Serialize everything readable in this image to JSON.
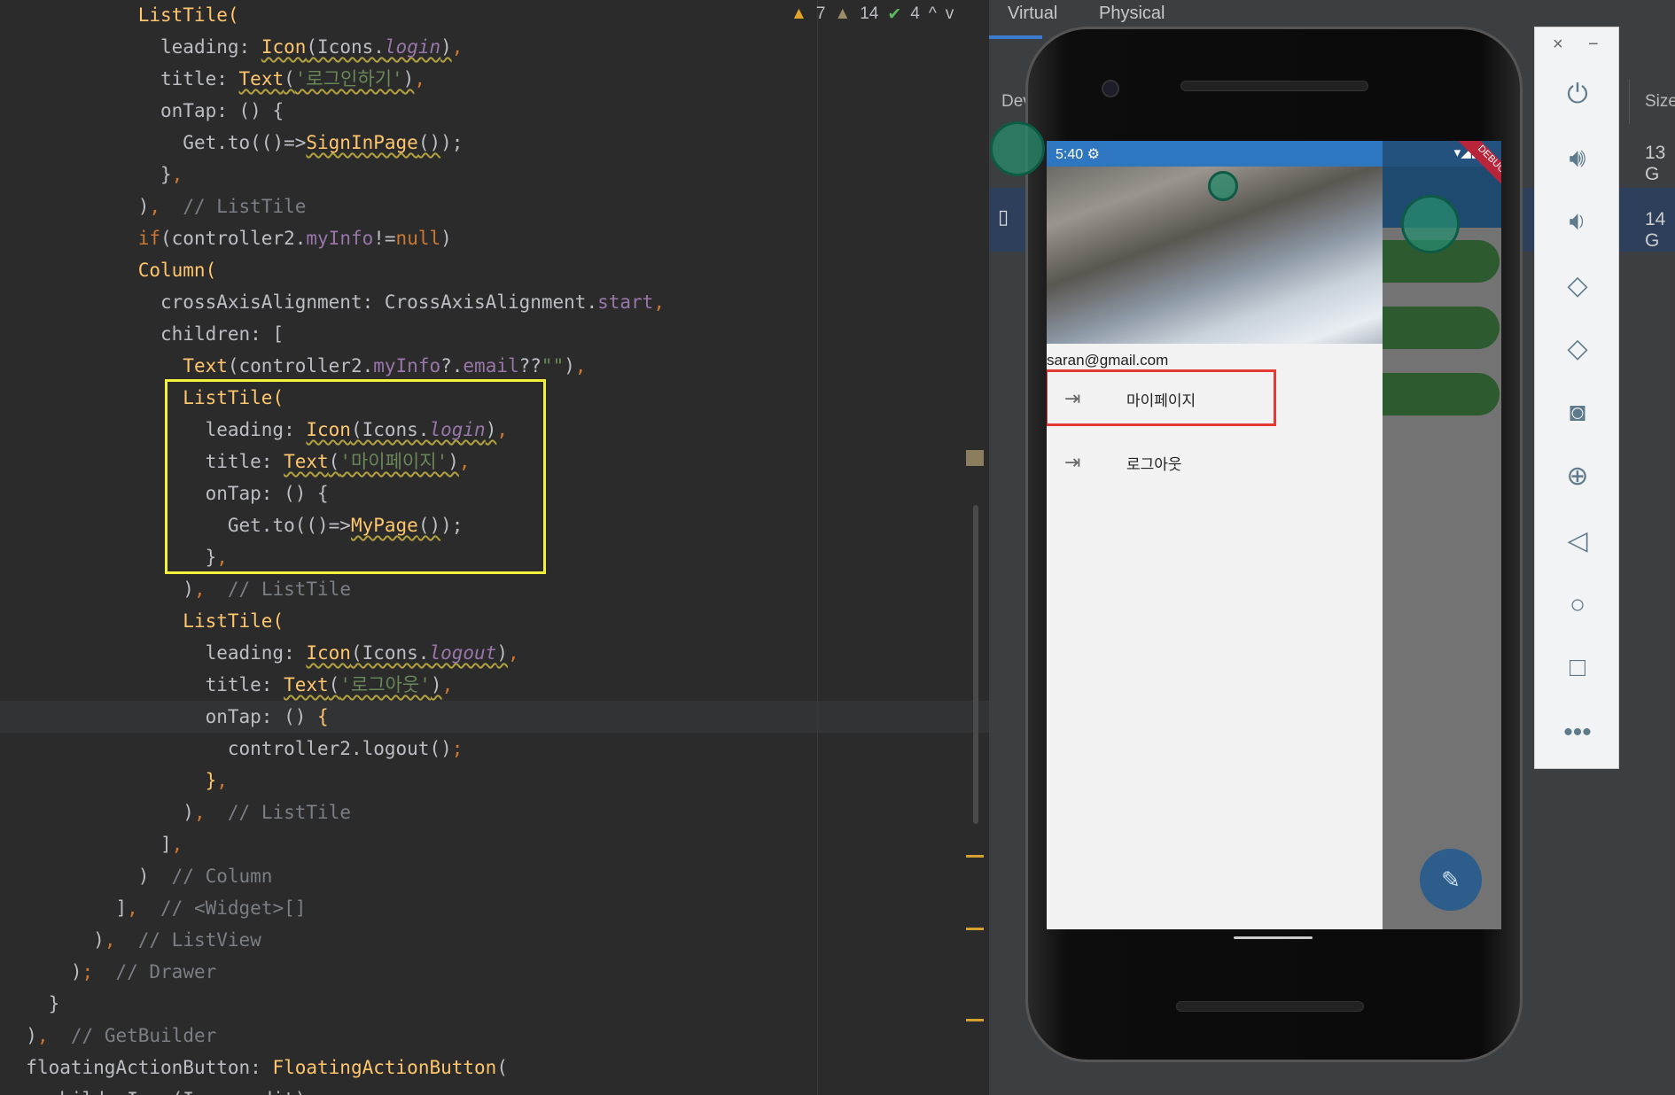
{
  "editor": {
    "inspections": {
      "warnings": "7",
      "weak_warnings": "14",
      "ok": "4",
      "up": "^",
      "down": "v"
    },
    "highlight_line": 22,
    "lines": [
      {
        "i": 12,
        "s": [
          [
            "ListTile(",
            "y"
          ]
        ]
      },
      {
        "i": 14,
        "s": [
          [
            "leading: ",
            "d"
          ],
          [
            "Icon",
            "y sq"
          ],
          [
            "(Icons.",
            "d sq"
          ],
          [
            "login",
            "p it sq"
          ],
          [
            ")",
            "d sq"
          ],
          [
            ",",
            "o"
          ]
        ]
      },
      {
        "i": 14,
        "s": [
          [
            "title: ",
            "d"
          ],
          [
            "Text",
            "y sq"
          ],
          [
            "(",
            "d sq"
          ],
          [
            "'로그인하기'",
            "g sq"
          ],
          [
            ")",
            "d sq"
          ],
          [
            ",",
            "o"
          ]
        ]
      },
      {
        "i": 14,
        "s": [
          [
            "onTap: () {",
            "d"
          ]
        ]
      },
      {
        "i": 16,
        "s": [
          [
            "Get.to(()=>",
            "d"
          ],
          [
            "SignInPage",
            "y sq"
          ],
          [
            "()",
            "d sq"
          ],
          [
            ");",
            "d"
          ]
        ]
      },
      {
        "i": 14,
        "s": [
          [
            "}",
            "d"
          ],
          [
            ",",
            "o"
          ]
        ]
      },
      {
        "i": 12,
        "s": [
          [
            ")",
            "d"
          ],
          [
            ",",
            "o"
          ],
          [
            "  // ListTile",
            "c"
          ]
        ]
      },
      {
        "i": 12,
        "s": [
          [
            "if",
            "o"
          ],
          [
            "(controller2.",
            "d"
          ],
          [
            "myInfo",
            "p"
          ],
          [
            "!=",
            "d"
          ],
          [
            "null",
            "o"
          ],
          [
            ")",
            "d"
          ]
        ]
      },
      {
        "i": 12,
        "s": [
          [
            "Column(",
            "y"
          ]
        ]
      },
      {
        "i": 14,
        "s": [
          [
            "crossAxisAlignment: CrossAxisAlignment.",
            "d"
          ],
          [
            "start",
            "p"
          ],
          [
            ",",
            "o"
          ]
        ]
      },
      {
        "i": 14,
        "s": [
          [
            "children: [",
            "d"
          ]
        ]
      },
      {
        "i": 16,
        "s": [
          [
            "Text",
            "y"
          ],
          [
            "(controller2.",
            "d"
          ],
          [
            "myInfo",
            "p"
          ],
          [
            "?.",
            "d"
          ],
          [
            "email",
            "p"
          ],
          [
            "??",
            "d"
          ],
          [
            "\"\"",
            "g"
          ],
          [
            ")",
            "d"
          ],
          [
            ",",
            "o"
          ]
        ]
      },
      {
        "i": 16,
        "s": [
          [
            "ListTile(",
            "y"
          ]
        ]
      },
      {
        "i": 18,
        "s": [
          [
            "leading: ",
            "d"
          ],
          [
            "Icon",
            "y sq"
          ],
          [
            "(Icons.",
            "d sq"
          ],
          [
            "login",
            "p it sq"
          ],
          [
            ")",
            "d sq"
          ],
          [
            ",",
            "o"
          ]
        ]
      },
      {
        "i": 18,
        "s": [
          [
            "title: ",
            "d"
          ],
          [
            "Text",
            "y sq"
          ],
          [
            "(",
            "d sq"
          ],
          [
            "'마이페이지'",
            "g sq"
          ],
          [
            ")",
            "d sq"
          ],
          [
            ",",
            "o"
          ]
        ]
      },
      {
        "i": 18,
        "s": [
          [
            "onTap: () {",
            "d"
          ]
        ]
      },
      {
        "i": 20,
        "s": [
          [
            "Get.to(()=>",
            "d"
          ],
          [
            "MyPage",
            "y sq"
          ],
          [
            "()",
            "d sq"
          ],
          [
            ");",
            "d"
          ]
        ]
      },
      {
        "i": 18,
        "s": [
          [
            "}",
            "d"
          ],
          [
            ",",
            "o"
          ]
        ]
      },
      {
        "i": 16,
        "s": [
          [
            ")",
            "d"
          ],
          [
            ",",
            "o"
          ],
          [
            "  // ListTile",
            "c"
          ]
        ]
      },
      {
        "i": 16,
        "s": [
          [
            "ListTile(",
            "y"
          ]
        ]
      },
      {
        "i": 18,
        "s": [
          [
            "leading: ",
            "d"
          ],
          [
            "Icon",
            "y sq"
          ],
          [
            "(Icons.",
            "d sq"
          ],
          [
            "logout",
            "p it sq"
          ],
          [
            ")",
            "d sq"
          ],
          [
            ",",
            "o"
          ]
        ]
      },
      {
        "i": 18,
        "s": [
          [
            "title: ",
            "d"
          ],
          [
            "Text",
            "y sq"
          ],
          [
            "(",
            "d sq"
          ],
          [
            "'로그아웃'",
            "g sq"
          ],
          [
            ")",
            "d sq"
          ],
          [
            ",",
            "o"
          ]
        ]
      },
      {
        "i": 18,
        "s": [
          [
            "onTap: () ",
            "d"
          ],
          [
            "{",
            "y"
          ]
        ]
      },
      {
        "i": 20,
        "s": [
          [
            "controller2.logout()",
            "d"
          ],
          [
            ";",
            "o"
          ]
        ]
      },
      {
        "i": 18,
        "s": [
          [
            "}",
            "y"
          ],
          [
            ",",
            "o"
          ]
        ]
      },
      {
        "i": 16,
        "s": [
          [
            ")",
            "d"
          ],
          [
            ",",
            "o"
          ],
          [
            "  // ListTile",
            "c"
          ]
        ]
      },
      {
        "i": 14,
        "s": [
          [
            "]",
            "d"
          ],
          [
            ",",
            "o"
          ]
        ]
      },
      {
        "i": 12,
        "s": [
          [
            ")",
            "d"
          ],
          [
            "  // Column",
            "c"
          ]
        ]
      },
      {
        "i": 10,
        "s": [
          [
            "]",
            "d"
          ],
          [
            ",",
            "o"
          ],
          [
            "  // <Widget>[]",
            "c"
          ]
        ]
      },
      {
        "i": 8,
        "s": [
          [
            ")",
            "d"
          ],
          [
            ",",
            "o"
          ],
          [
            "  // ListView",
            "c"
          ]
        ]
      },
      {
        "i": 6,
        "s": [
          [
            ")",
            "d"
          ],
          [
            ";",
            "o"
          ],
          [
            "  // Drawer",
            "c"
          ]
        ]
      },
      {
        "i": 4,
        "s": [
          [
            "}",
            "d"
          ]
        ]
      },
      {
        "i": 2,
        "s": [
          [
            ")",
            "d"
          ],
          [
            ",",
            "o"
          ],
          [
            "  // GetBuilder",
            "c"
          ]
        ]
      },
      {
        "i": 2,
        "s": [
          [
            "floatingActionButton: ",
            "d"
          ],
          [
            "FloatingActionButton",
            "y"
          ],
          [
            "(",
            "d"
          ]
        ]
      },
      {
        "i": 4,
        "s": [
          [
            "child: Icon(Icons.edit),",
            "d"
          ]
        ]
      }
    ]
  },
  "device_manager": {
    "tabs": [
      "Virtual",
      "Physical"
    ],
    "device_col": "Dev",
    "size_col": "Size",
    "rows": [
      {
        "size": "13 G"
      },
      {
        "size": "14 G"
      }
    ]
  },
  "phone": {
    "time": "5:40",
    "status_icons": "▾◢▮",
    "debug_banner": "DEBUG",
    "email": "saran@gmail.com",
    "drawer_items": [
      {
        "icon": "login-icon",
        "label": "마이페이지"
      },
      {
        "icon": "logout-icon",
        "label": "로그아웃"
      }
    ],
    "fab_icon": "edit-icon"
  },
  "emulator_toolbar": {
    "close": "×",
    "minimize": "−"
  },
  "colors": {
    "highlight_box": "#f5f03a",
    "red_box": "#e53935",
    "app_blue": "#2f76c0"
  }
}
